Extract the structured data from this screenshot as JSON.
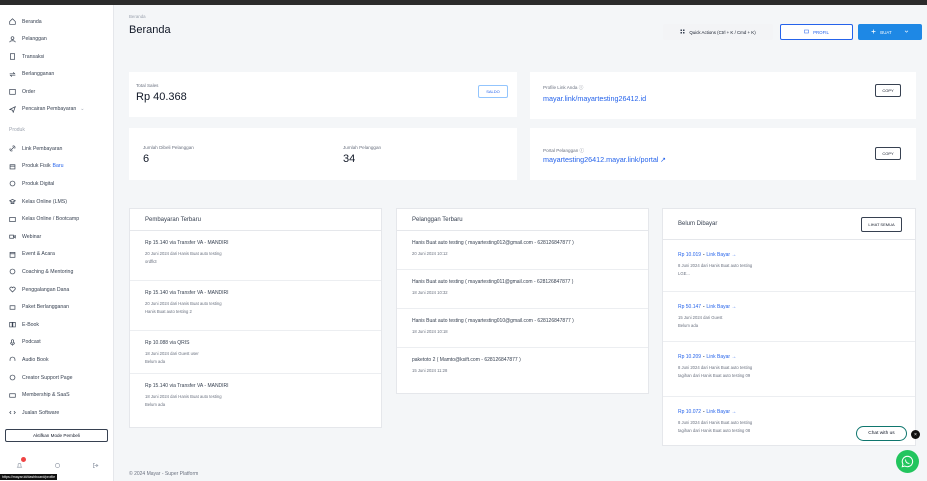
{
  "sidebar": {
    "items": [
      {
        "label": "Beranda",
        "icon": "home-icon"
      },
      {
        "label": "Pelanggan",
        "icon": "users-icon"
      },
      {
        "label": "Transaksi",
        "icon": "receipt-icon"
      },
      {
        "label": "Berlangganan",
        "icon": "repeat-icon"
      },
      {
        "label": "Order",
        "icon": "order-icon"
      },
      {
        "label": "Pencairan Pembayaran",
        "icon": "send-icon"
      }
    ],
    "section_label": "Produk",
    "products": [
      {
        "label": "Link Pembayaran",
        "icon": "link-icon"
      },
      {
        "label": "Produk Fisik",
        "badge": "Baru",
        "icon": "box-icon"
      },
      {
        "label": "Produk Digital",
        "icon": "digital-icon"
      },
      {
        "label": "Kelas Online (LMS)",
        "icon": "class-icon"
      },
      {
        "label": "Kelas Online / Bootcamp",
        "icon": "bootcamp-icon"
      },
      {
        "label": "Webinar",
        "icon": "webinar-icon"
      },
      {
        "label": "Event & Acara",
        "icon": "calendar-icon"
      },
      {
        "label": "Coaching & Mentoring",
        "icon": "coaching-icon"
      },
      {
        "label": "Penggalangan Dana",
        "icon": "heart-icon"
      },
      {
        "label": "Paket Berlangganan",
        "icon": "package-icon"
      },
      {
        "label": "E-Book",
        "icon": "book-icon"
      },
      {
        "label": "Podcast",
        "icon": "mic-icon"
      },
      {
        "label": "Audio Book",
        "icon": "headphones-icon"
      },
      {
        "label": "Creator Support Page",
        "icon": "support-icon"
      },
      {
        "label": "Membership & SaaS",
        "icon": "membership-icon"
      },
      {
        "label": "Jualan Software",
        "icon": "software-icon"
      }
    ],
    "mode_button": "Aktifkan Mode Pembeli",
    "tooltip": "https://mayar.id/dashboard/profile"
  },
  "header": {
    "breadcrumb": "Beranda",
    "title": "Beranda",
    "quick_actions": "Quick Actions (Ctrl + K / Cmd + K)",
    "profile_button": "PROFIL",
    "new_button": "BUAT"
  },
  "stats": {
    "total_sales_label": "Total Sales",
    "total_sales_value": "Rp 40.368",
    "total_sales_button": "SALDO",
    "total_products_label": "Jumlah Dibeli Pelanggan",
    "total_products_value": "6",
    "total_customers_label": "Jumlah Pelanggan",
    "total_customers_value": "34"
  },
  "links": {
    "profile_label": "Profile Link Anda",
    "profile_url": "mayar.link/mayartesting26412.id",
    "profile_button": "COPY",
    "portal_label": "Portal Pelanggan",
    "portal_url": "mayartesting26412.mayar.link/portal",
    "portal_button": "COPY"
  },
  "payments": {
    "title": "Pembayaran Terbaru",
    "rows": [
      {
        "t1": "Rp 15.140 via Transfer VA - MANDIRI",
        "t2": "20 Juni 2024 dari Hanis Buat auto testing",
        "t3": "ordfk3"
      },
      {
        "t1": "Rp 15.140 via Transfer VA - MANDIRI",
        "t2": "20 Juni 2024 dari Hanis Buat auto testing",
        "t3": "Hanis Buat auto testing 2"
      },
      {
        "t1": "Rp 10.088 via QRIS",
        "t2": "18 Juni 2024 dari Guest user",
        "t3": "Belum ada"
      },
      {
        "t1": "Rp 15.140 via Transfer VA - MANDIRI",
        "t2": "18 Juni 2024 dari Hanis Buat auto testing",
        "t3": "Belum ada"
      }
    ]
  },
  "customers": {
    "title": "Pelanggan Terbaru",
    "rows": [
      {
        "t1": "Hanis Buat auto testing ( mayartesting012@gmail.com - 628126847877 )",
        "t2": "20 Juni 2024 10:12"
      },
      {
        "t1": "Hanis Buat auto testing ( mayartesting011@gmail.com - 628126847877 )",
        "t2": "18 Juni 2024 10:32"
      },
      {
        "t1": "Hanis Buat auto testing ( mayartesting010@gmail.com - 628126847877 )",
        "t2": "18 Juni 2024 10:18"
      },
      {
        "t1": "paketoto 2 ( Mamto@ksift.com - 628126847877 )",
        "t2": "15 Juni 2024 11:28"
      }
    ]
  },
  "unpaid": {
    "title": "Belum Dibayar",
    "button": "LIHAT SEMUA",
    "rows": [
      {
        "t1": "Rp 10.019",
        "t1b": "Link Bayar →",
        "t2": "8 Juni 2024 dari Hanis Buat auto testing",
        "t3": "LGE..."
      },
      {
        "t1": "Rp 50.147",
        "t1b": "Link Bayar →",
        "t2": "15 Juni 2024 dari Guest",
        "t3": "Belum ada"
      },
      {
        "t1": "Rp 10.209",
        "t1b": "Link Bayar →",
        "t2": "8 Juni 2024 dari Hanis Buat auto testing",
        "t3": "tagihan dari Hanis Buat auto testing 09"
      },
      {
        "t1": "Rp 10.072",
        "t1b": "Link Bayar →",
        "t2": "8 Juni 2024 dari Hanis Buat auto testing",
        "t3": "tagihan dari Hanis Buat auto testing 08"
      }
    ]
  },
  "footer": {
    "copyright": "© 2024 Mayar - Super Platform",
    "chat": "Chat with us"
  },
  "colors": {
    "accent": "#1e88e5",
    "link": "#2563eb",
    "whatsapp": "#22c55e"
  }
}
